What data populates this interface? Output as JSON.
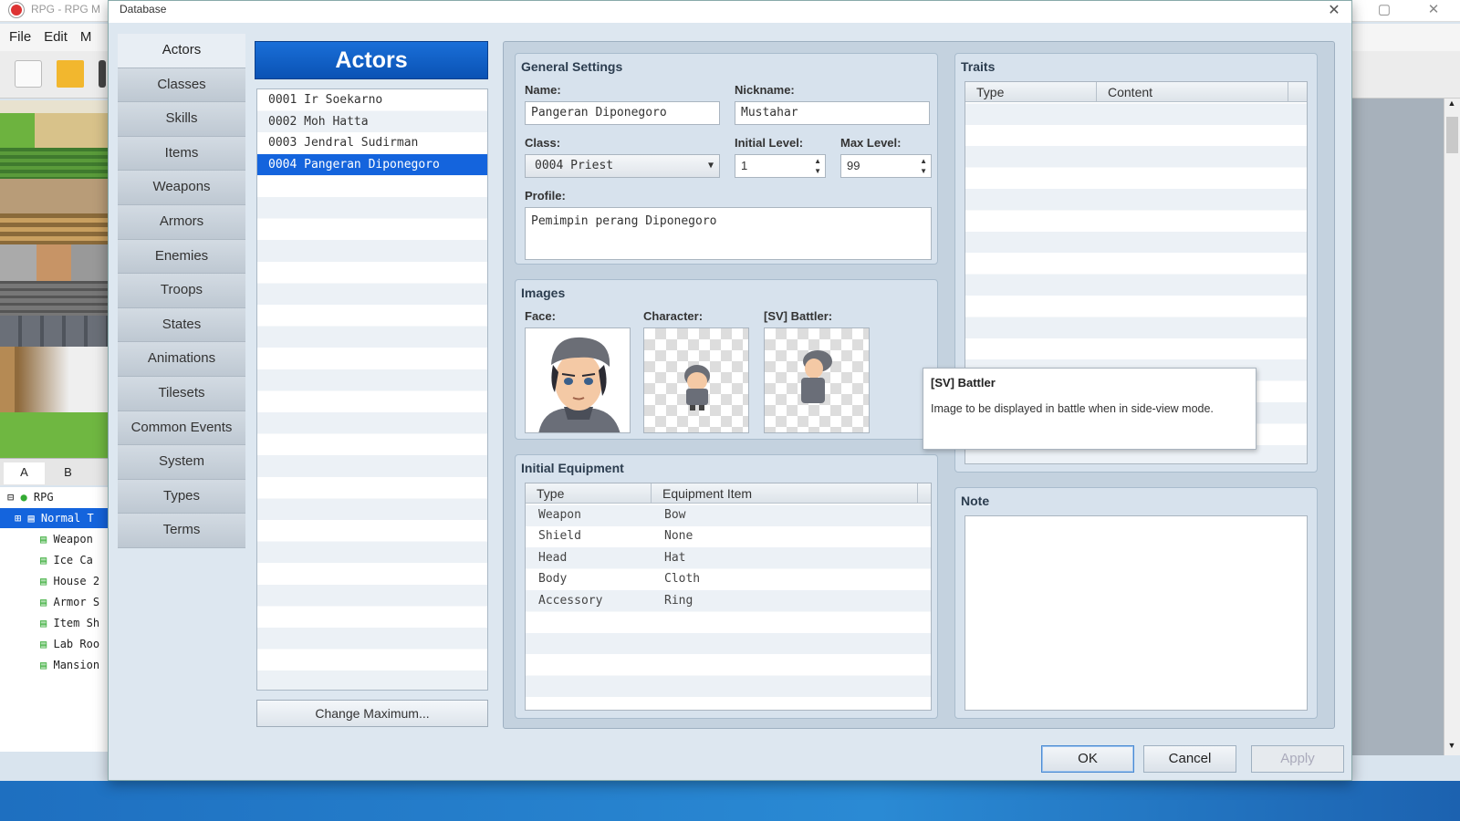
{
  "bg_app": {
    "title": "RPG - RPG M",
    "menu": [
      "File",
      "Edit",
      "M"
    ],
    "tile_tabs": [
      "A",
      "B"
    ],
    "map_tree": [
      {
        "label": "RPG",
        "level": 0
      },
      {
        "label": "Normal T",
        "level": 1
      },
      {
        "label": "Weapon",
        "level": 2
      },
      {
        "label": "Ice Ca",
        "level": 2
      },
      {
        "label": "House 2",
        "level": 2
      },
      {
        "label": "Armor S",
        "level": 2
      },
      {
        "label": "Item Sh",
        "level": 2
      },
      {
        "label": "Lab Roo",
        "level": 2
      },
      {
        "label": "Mansion",
        "level": 2
      }
    ]
  },
  "dialog": {
    "title": "Database",
    "close_glyph": "✕"
  },
  "categories": [
    "Actors",
    "Classes",
    "Skills",
    "Items",
    "Weapons",
    "Armors",
    "Enemies",
    "Troops",
    "States",
    "Animations",
    "Tilesets",
    "Common Events",
    "System",
    "Types",
    "Terms"
  ],
  "actors": {
    "header": "Actors",
    "list": [
      "0001 Ir Soekarno",
      "0002 Moh Hatta",
      "0003 Jendral Sudirman",
      "0004 Pangeran Diponegoro"
    ],
    "selected_index": 3,
    "change_max_label": "Change Maximum..."
  },
  "general": {
    "title": "General Settings",
    "name_label": "Name:",
    "name_value": "Pangeran Diponegoro",
    "nickname_label": "Nickname:",
    "nickname_value": "Mustahar",
    "class_label": "Class:",
    "class_value": "0004 Priest",
    "initial_level_label": "Initial Level:",
    "initial_level_value": "1",
    "max_level_label": "Max Level:",
    "max_level_value": "99",
    "profile_label": "Profile:",
    "profile_value": "Pemimpin perang Diponegoro"
  },
  "images": {
    "title": "Images",
    "face_label": "Face:",
    "character_label": "Character:",
    "battler_label": "[SV] Battler:"
  },
  "equipment": {
    "title": "Initial Equipment",
    "col_type": "Type",
    "col_item": "Equipment Item",
    "rows": [
      {
        "type": "Weapon",
        "item": "Bow"
      },
      {
        "type": "Shield",
        "item": "None"
      },
      {
        "type": "Head",
        "item": "Hat"
      },
      {
        "type": "Body",
        "item": "Cloth"
      },
      {
        "type": "Accessory",
        "item": "Ring"
      }
    ]
  },
  "traits": {
    "title": "Traits",
    "col_type": "Type",
    "col_content": "Content"
  },
  "note": {
    "title": "Note"
  },
  "tooltip": {
    "title": "[SV] Battler",
    "text": "Image to be displayed in battle when in side-view mode."
  },
  "buttons": {
    "ok": "OK",
    "cancel": "Cancel",
    "apply": "Apply"
  },
  "colors": {
    "accent": "#1464dd",
    "header_blue": "#0a52b4",
    "taskbar": "#2a8ad4"
  }
}
